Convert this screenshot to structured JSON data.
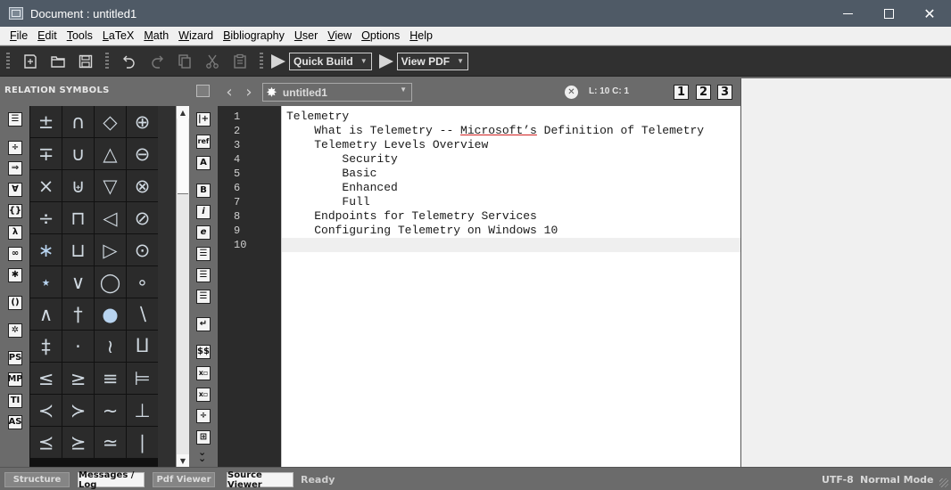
{
  "window": {
    "title": "Document : untitled1",
    "minimize_icon": "minimize-icon",
    "maximize_icon": "maximize-icon",
    "close_icon": "close-icon"
  },
  "menubar": {
    "items": [
      {
        "label": "File",
        "mnemonic": "F",
        "rest": "ile"
      },
      {
        "label": "Edit",
        "mnemonic": "E",
        "rest": "dit"
      },
      {
        "label": "Tools",
        "mnemonic": "T",
        "rest": "ools"
      },
      {
        "label": "LaTeX",
        "mnemonic": "L",
        "rest": "aTeX"
      },
      {
        "label": "Math",
        "mnemonic": "M",
        "rest": "ath"
      },
      {
        "label": "Wizard",
        "mnemonic": "W",
        "rest": "izard"
      },
      {
        "label": "Bibliography",
        "mnemonic": "B",
        "rest": "ibliography"
      },
      {
        "label": "User",
        "mnemonic": "U",
        "rest": "ser"
      },
      {
        "label": "View",
        "mnemonic": "V",
        "rest": "iew"
      },
      {
        "label": "Options",
        "mnemonic": "O",
        "rest": "ptions"
      },
      {
        "label": "Help",
        "mnemonic": "H",
        "rest": "elp"
      }
    ]
  },
  "toolbar": {
    "icons": [
      "new-file-icon",
      "open-folder-icon",
      "save-icon",
      "undo-icon",
      "redo-icon",
      "copy-icon",
      "cut-icon",
      "paste-icon"
    ],
    "quick_build_label": "Quick Build",
    "view_pdf_label": "View PDF"
  },
  "left_panel": {
    "title": "RELATION SYMBOLS",
    "category_buttons": [
      {
        "name": "structure-list",
        "glyph": "☰"
      },
      {
        "name": "relation",
        "glyph": "÷"
      },
      {
        "name": "arrows",
        "glyph": "⇒"
      },
      {
        "name": "misc",
        "glyph": "∀"
      },
      {
        "name": "delimiters",
        "glyph": "{}"
      },
      {
        "name": "greek",
        "glyph": "λ"
      },
      {
        "name": "misc-math",
        "glyph": "∞"
      },
      {
        "name": "most-used",
        "glyph": "✱"
      },
      {
        "name": "left-right",
        "glyph": "()"
      },
      {
        "name": "favorites",
        "glyph": "✲"
      },
      {
        "name": "pstricks",
        "glyph": "PS"
      },
      {
        "name": "metapost",
        "glyph": "MP"
      },
      {
        "name": "tikz",
        "glyph": "TI"
      },
      {
        "name": "asymptote",
        "glyph": "AS"
      }
    ],
    "symbols": [
      "±",
      "∩",
      "◇",
      "⊕",
      "∓",
      "∪",
      "△",
      "⊖",
      "×",
      "⊎",
      "▽",
      "⊗",
      "÷",
      "⊓",
      "◁",
      "⊘",
      "∗",
      "⊔",
      "▷",
      "⊙",
      "⋆",
      "∨",
      "◯",
      "∘",
      "∧",
      "†",
      "●",
      "∖",
      "‡",
      "·",
      "≀",
      "⨿",
      "≤",
      "≥",
      "≡",
      "⊨",
      "≺",
      "≻",
      "∼",
      "⊥",
      "⪯",
      "⪰",
      "≃",
      "∣"
    ]
  },
  "format_buttons": [
    {
      "name": "insert-label",
      "glyph": "|+"
    },
    {
      "name": "insert-ref",
      "glyph": "ref"
    },
    {
      "name": "font-size",
      "glyph": "A"
    },
    {
      "name": "bold",
      "glyph": "B"
    },
    {
      "name": "italic",
      "glyph": "i"
    },
    {
      "name": "emphasis",
      "glyph": "e"
    },
    {
      "name": "align-left",
      "glyph": "☰"
    },
    {
      "name": "align-center",
      "glyph": "☰"
    },
    {
      "name": "align-right",
      "glyph": "☰"
    },
    {
      "name": "new-line",
      "glyph": "↵"
    },
    {
      "name": "math-mode",
      "glyph": "$$"
    },
    {
      "name": "subscript",
      "glyph": "x▫"
    },
    {
      "name": "superscript",
      "glyph": "x▫"
    },
    {
      "name": "fraction",
      "glyph": "÷"
    },
    {
      "name": "matrix",
      "glyph": "⊞"
    }
  ],
  "editor": {
    "document_name": "untitled1",
    "cursor_position": "L: 10 C: 1",
    "bookmarks": [
      "1",
      "2",
      "3"
    ],
    "lines": [
      {
        "number": "1",
        "indent": "",
        "text": "Telemetry"
      },
      {
        "number": "2",
        "indent": "    ",
        "text_before": "What is Telemetry -- ",
        "misspelled": "Microsoft’s",
        "text_after": " Definition of Telemetry"
      },
      {
        "number": "3",
        "indent": "    ",
        "text": "Telemetry Levels Overview"
      },
      {
        "number": "4",
        "indent": "        ",
        "text": "Security"
      },
      {
        "number": "5",
        "indent": "        ",
        "text": "Basic"
      },
      {
        "number": "6",
        "indent": "        ",
        "text": "Enhanced"
      },
      {
        "number": "7",
        "indent": "        ",
        "text": "Full"
      },
      {
        "number": "8",
        "indent": "    ",
        "text": "Endpoints for Telemetry Services"
      },
      {
        "number": "9",
        "indent": "    ",
        "text": "Configuring Telemetry on Windows 10"
      },
      {
        "number": "10",
        "indent": "",
        "text": ""
      }
    ]
  },
  "statusbar": {
    "tabs": [
      {
        "label": "Structure",
        "active": false
      },
      {
        "label": "Messages / Log",
        "active": true
      },
      {
        "label": "Pdf Viewer",
        "active": false
      },
      {
        "label": "Source Viewer",
        "active": true
      }
    ],
    "status": "Ready",
    "encoding": "UTF-8",
    "mode": "Normal Mode"
  },
  "colors": {
    "titlebar": "#4f5a66",
    "toolbar": "#303030",
    "panel": "#6b6b6b",
    "symbol_cell": "#2b2b2b",
    "spellcheck": "#d02020"
  }
}
